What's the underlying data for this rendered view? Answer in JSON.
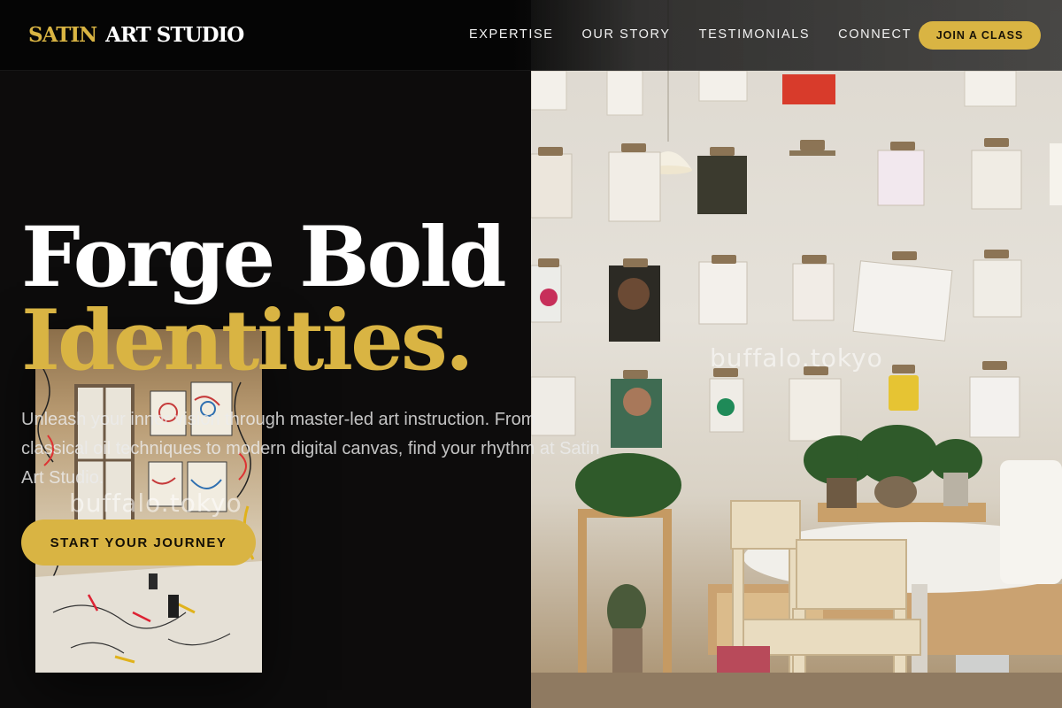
{
  "brand": {
    "accent_word": "SATIN",
    "rest_words": "ART STUDIO"
  },
  "nav": {
    "items": [
      {
        "label": "EXPERTISE"
      },
      {
        "label": "OUR STORY"
      },
      {
        "label": "TESTIMONIALS"
      },
      {
        "label": "CONNECT"
      }
    ],
    "cta_label": "JOIN A CLASS"
  },
  "hero": {
    "title_line1": "Forge Bold",
    "title_line2": "Identities.",
    "subtitle": "Unleash your inner vision through master-led art instruction. From classical oil techniques to modern digital canvas, find your rhythm at Satin Art Studio.",
    "cta_label": "START YOUR JOURNEY"
  },
  "images": {
    "hero_photo_watermark": "buffalo.tokyo",
    "studio_photo_watermark": "buffalo.tokyo"
  },
  "colors": {
    "accent": "#d9b443",
    "background": "#0d0c0c",
    "text": "#ffffff"
  }
}
